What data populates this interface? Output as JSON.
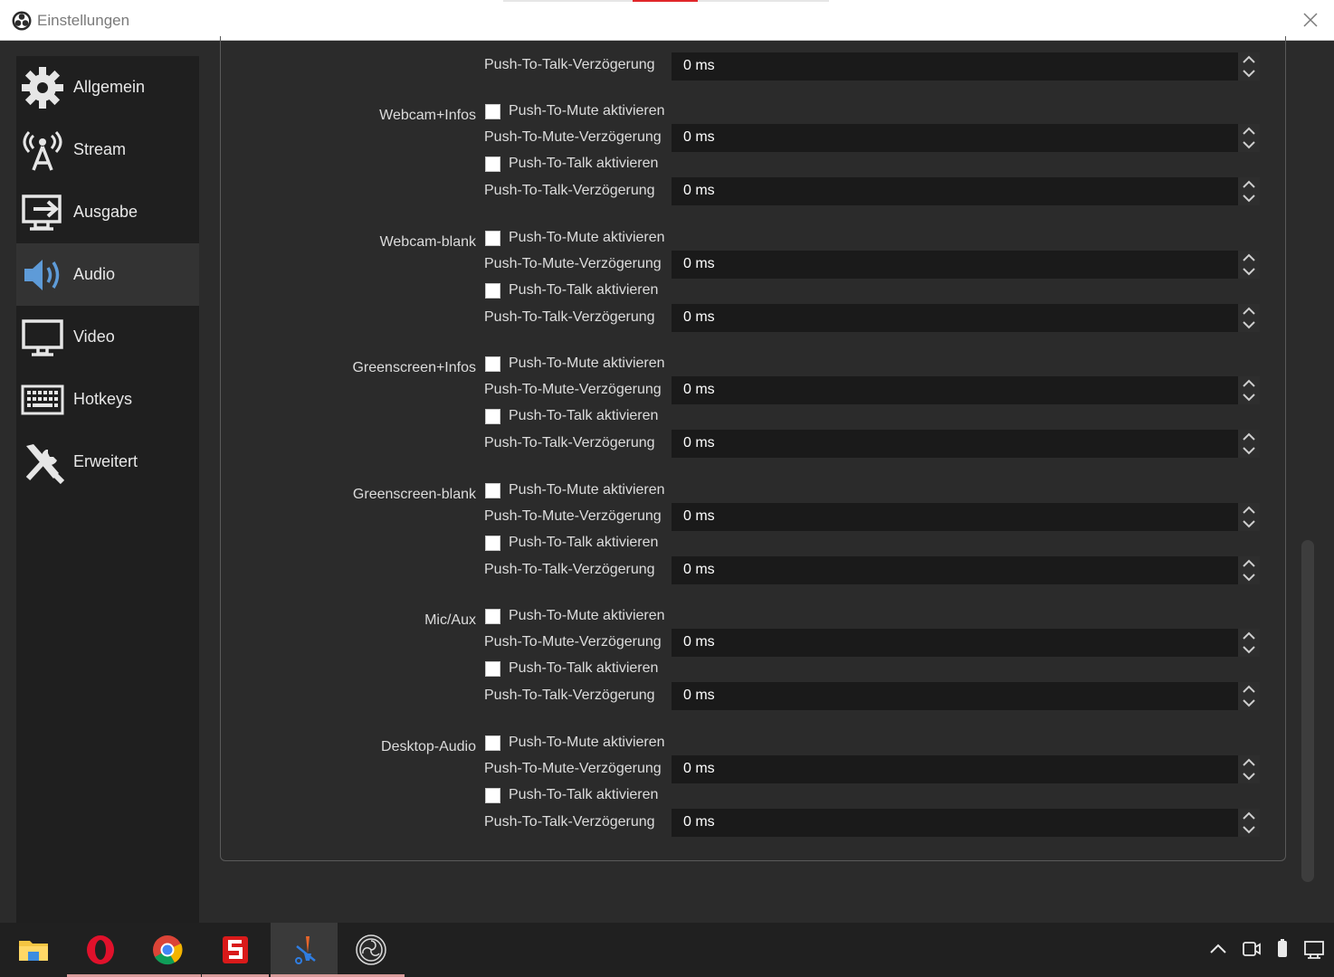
{
  "window": {
    "title": "Einstellungen",
    "app_icon": "obs-logo-icon",
    "close_icon": "close-icon"
  },
  "sidebar": {
    "active": "Audio",
    "items": [
      {
        "label": "Allgemein",
        "icon": "gear-icon"
      },
      {
        "label": "Stream",
        "icon": "broadcast-antenna-icon"
      },
      {
        "label": "Ausgabe",
        "icon": "output-monitor-arrow-icon"
      },
      {
        "label": "Audio",
        "icon": "speaker-icon"
      },
      {
        "label": "Video",
        "icon": "monitor-icon"
      },
      {
        "label": "Hotkeys",
        "icon": "keyboard-icon"
      },
      {
        "label": "Erweitert",
        "icon": "tools-icon"
      }
    ]
  },
  "hotkeys": {
    "top_partial": {
      "ptt_delay_label": "Push-To-Talk-Verzögerung",
      "ptt_delay_value": "0 ms"
    },
    "sources": [
      {
        "name": "Webcam+Infos",
        "ptm_label": "Push-To-Mute aktivieren",
        "ptm_delay_label": "Push-To-Mute-Verzögerung",
        "ptm_delay_value": "0 ms",
        "ptt_label": "Push-To-Talk aktivieren",
        "ptt_delay_label": "Push-To-Talk-Verzögerung",
        "ptt_delay_value": "0 ms"
      },
      {
        "name": "Webcam-blank",
        "ptm_label": "Push-To-Mute aktivieren",
        "ptm_delay_label": "Push-To-Mute-Verzögerung",
        "ptm_delay_value": "0 ms",
        "ptt_label": "Push-To-Talk aktivieren",
        "ptt_delay_label": "Push-To-Talk-Verzögerung",
        "ptt_delay_value": "0 ms"
      },
      {
        "name": "Greenscreen+Infos",
        "ptm_label": "Push-To-Mute aktivieren",
        "ptm_delay_label": "Push-To-Mute-Verzögerung",
        "ptm_delay_value": "0 ms",
        "ptt_label": "Push-To-Talk aktivieren",
        "ptt_delay_label": "Push-To-Talk-Verzögerung",
        "ptt_delay_value": "0 ms"
      },
      {
        "name": "Greenscreen-blank",
        "ptm_label": "Push-To-Mute aktivieren",
        "ptm_delay_label": "Push-To-Mute-Verzögerung",
        "ptm_delay_value": "0 ms",
        "ptt_label": "Push-To-Talk aktivieren",
        "ptt_delay_label": "Push-To-Talk-Verzögerung",
        "ptt_delay_value": "0 ms"
      },
      {
        "name": "Mic/Aux",
        "ptm_label": "Push-To-Mute aktivieren",
        "ptm_delay_label": "Push-To-Mute-Verzögerung",
        "ptm_delay_value": "0 ms",
        "ptt_label": "Push-To-Talk aktivieren",
        "ptt_delay_label": "Push-To-Talk-Verzögerung",
        "ptt_delay_value": "0 ms"
      },
      {
        "name": "Desktop-Audio",
        "ptm_label": "Push-To-Mute aktivieren",
        "ptm_delay_label": "Push-To-Mute-Verzögerung",
        "ptm_delay_value": "0 ms",
        "ptt_label": "Push-To-Talk aktivieren",
        "ptt_delay_label": "Push-To-Talk-Verzögerung",
        "ptt_delay_value": "0 ms"
      }
    ]
  },
  "taskbar": {
    "apps": [
      {
        "icon": "file-explorer-icon"
      },
      {
        "icon": "opera-icon"
      },
      {
        "icon": "chrome-icon"
      },
      {
        "icon": "red-s-app-icon"
      },
      {
        "icon": "paint-tool-icon"
      },
      {
        "icon": "obs-icon"
      }
    ],
    "tray": [
      "chevron-up-icon",
      "meet-now-icon",
      "battery-icon",
      "network-icon"
    ]
  },
  "colors": {
    "background": "#2b2b2b",
    "sidebar": "#1f1f1f",
    "sidebar_active": "#333333",
    "input": "#1a1a1a",
    "accent_red": "#e0262a"
  }
}
